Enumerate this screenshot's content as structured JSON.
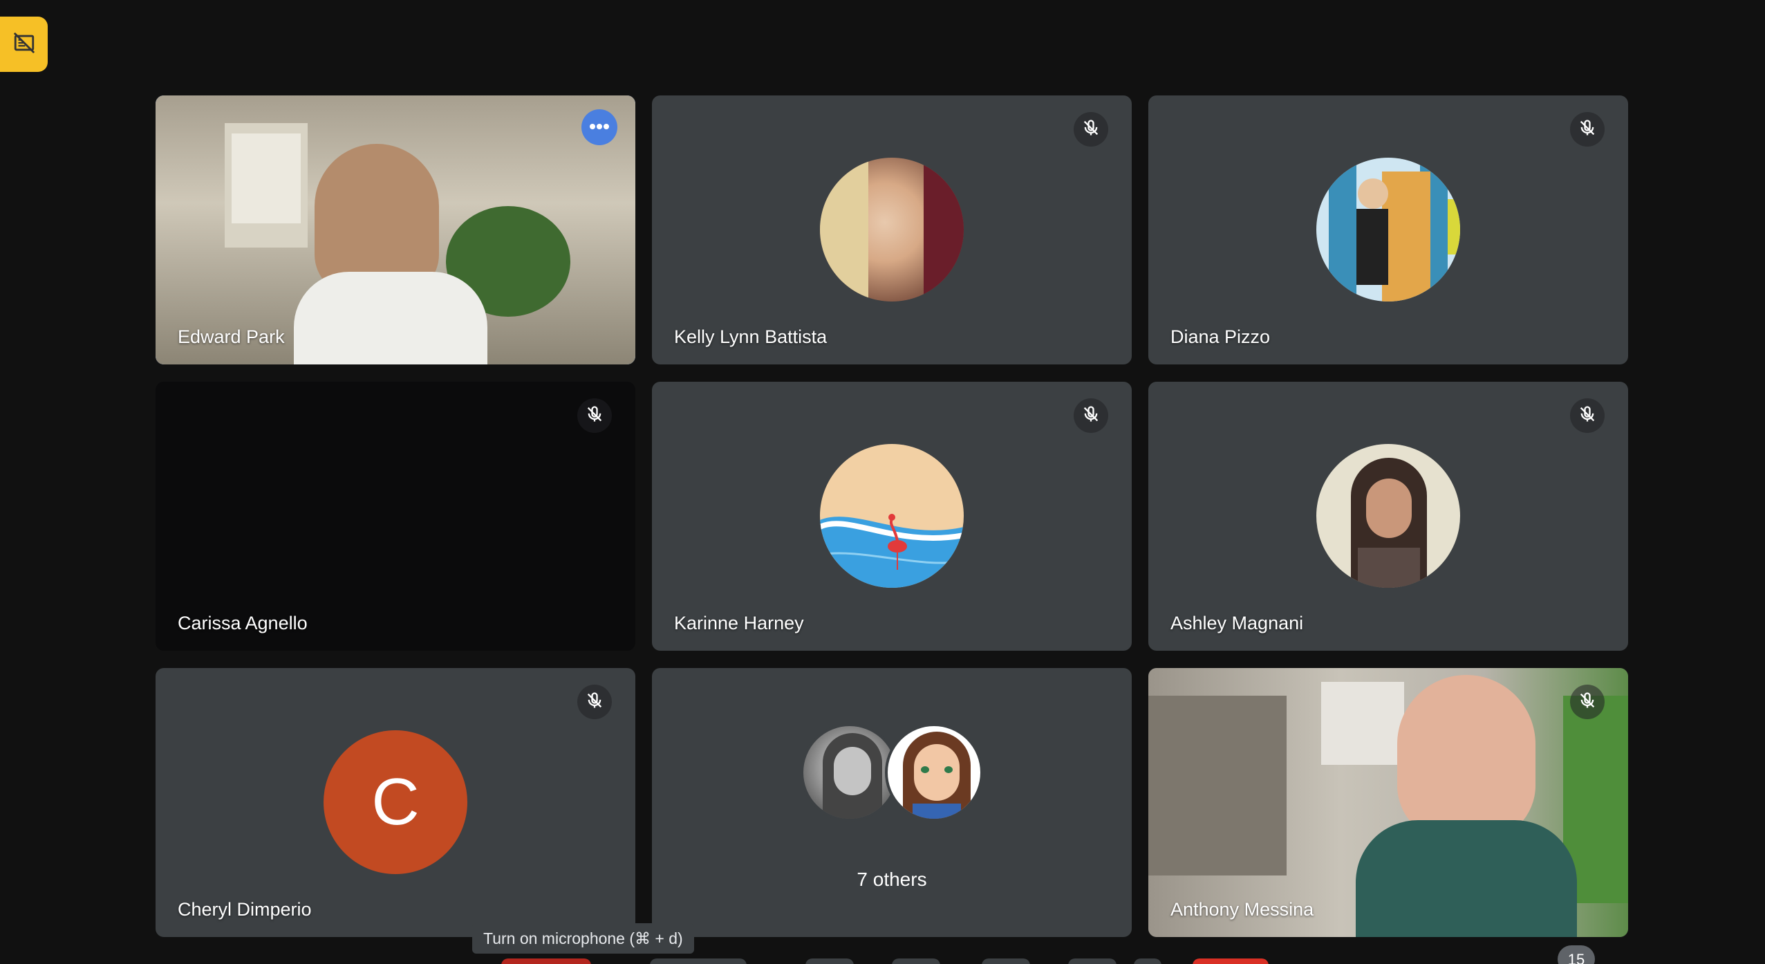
{
  "participants": [
    {
      "name": "Edward Park",
      "muted": false,
      "active": true,
      "display": "video"
    },
    {
      "name": "Kelly Lynn Battista",
      "muted": true,
      "display": "photo-avatar"
    },
    {
      "name": "Diana Pizzo",
      "muted": true,
      "display": "bitmoji-avatar"
    },
    {
      "name": "Carissa Agnello",
      "muted": true,
      "display": "camera-off"
    },
    {
      "name": "Karinne Harney",
      "muted": true,
      "display": "beach-avatar"
    },
    {
      "name": "Ashley Magnani",
      "muted": true,
      "display": "photo-avatar"
    },
    {
      "name": "Cheryl Dimperio",
      "muted": true,
      "display": "letter-avatar",
      "initial": "C"
    },
    {
      "name": "Anthony Messina",
      "muted": true,
      "display": "video"
    }
  ],
  "others": {
    "label": "7 others"
  },
  "tooltip": {
    "text": "Turn on microphone (⌘ + d)"
  },
  "participant_count": "15",
  "colors": {
    "background": "#111111",
    "tile": "#3c4043",
    "active_outline": "#8ab4f8",
    "badge": "#f6c026",
    "avatar_letter_bg": "#c24a22"
  }
}
